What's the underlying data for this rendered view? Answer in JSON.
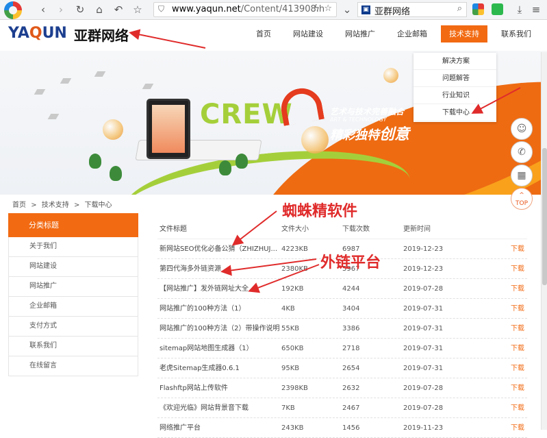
{
  "browser": {
    "url_host": "www.yaqun.net",
    "url_path": "/Content/413908.h",
    "tab_title": "亚群网络"
  },
  "site": {
    "brand_en_a": "YA",
    "brand_en_q": "Q",
    "brand_en_b": "UN",
    "brand_cn": "亚群网络",
    "nav": [
      "首页",
      "网站建设",
      "网站推广",
      "企业邮箱",
      "技术支持",
      "联系我们"
    ],
    "submenu": [
      "解决方案",
      "问题解答",
      "行业知识",
      "下载中心"
    ]
  },
  "banner": {
    "crew_text": "CREW",
    "slogan_top": "艺术与技术完善融合",
    "slogan_en": "ART & TECHNOLOGY",
    "slogan_main_a": "精彩独特",
    "slogan_main_b": "创意"
  },
  "float": {
    "top_label": "TOP"
  },
  "breadcrumb": [
    "首页",
    ">",
    "技术支持",
    ">",
    "下载中心"
  ],
  "sidebar": {
    "title": "分类标题",
    "items": [
      "关于我们",
      "网站建设",
      "网站推广",
      "企业邮箱",
      "支付方式",
      "联系我们",
      "在线留言"
    ]
  },
  "table": {
    "headers": [
      "文件标题",
      "文件大小",
      "下载次数",
      "更新时间",
      ""
    ],
    "rows": [
      {
        "title": "新网站SEO优化必备公猜（ZHIZHUJ...",
        "size": "4223KB",
        "count": "6987",
        "date": "2019-12-23",
        "action": "下载"
      },
      {
        "title": "第四代海多外链资源",
        "size": "2380KB",
        "count": "5967",
        "date": "2019-12-23",
        "action": "下载"
      },
      {
        "title": "【网站推广】发外链网址大全",
        "size": "192KB",
        "count": "4244",
        "date": "2019-07-28",
        "action": "下载"
      },
      {
        "title": "网站推广的100种方法（1）",
        "size": "4KB",
        "count": "3404",
        "date": "2019-07-31",
        "action": "下载"
      },
      {
        "title": "网站推广的100种方法（2）带操作说明",
        "size": "55KB",
        "count": "3386",
        "date": "2019-07-31",
        "action": "下载"
      },
      {
        "title": "sitemap网站地图生成器（1）",
        "size": "650KB",
        "count": "2718",
        "date": "2019-07-31",
        "action": "下载"
      },
      {
        "title": "老虎Sitemap生成器0.6.1",
        "size": "95KB",
        "count": "2654",
        "date": "2019-07-31",
        "action": "下载"
      },
      {
        "title": "Flashftp网站上传软件",
        "size": "2398KB",
        "count": "2632",
        "date": "2019-07-28",
        "action": "下载"
      },
      {
        "title": "《欢迎光临》网站背景音下载",
        "size": "7KB",
        "count": "2467",
        "date": "2019-07-28",
        "action": "下载"
      },
      {
        "title": "网络推广平台",
        "size": "243KB",
        "count": "1456",
        "date": "2019-11-23",
        "action": "下载"
      }
    ]
  },
  "annotations": {
    "label1": "蜘蛛精软件",
    "label2": "外链平台"
  },
  "colors": {
    "accent": "#f26a12",
    "brand_blue": "#1d3f8f",
    "annotation": "#e02b2b"
  }
}
